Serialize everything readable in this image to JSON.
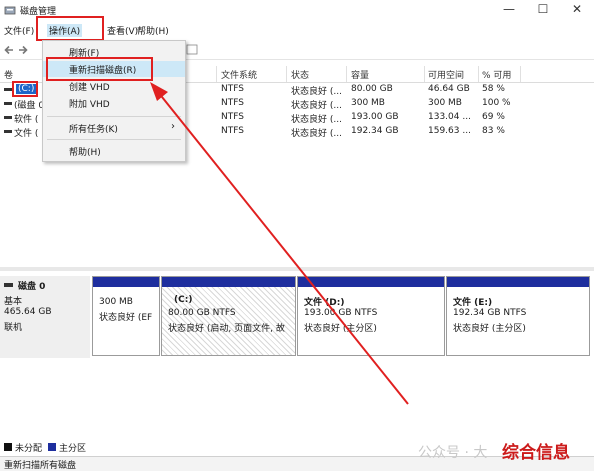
{
  "window": {
    "title": "磁盘管理",
    "minimize": "—",
    "maximize": "☐",
    "close": "✕"
  },
  "menu": [
    "文件(F)",
    "操作(A)",
    "查看(V)",
    "帮助(H)"
  ],
  "dropdown": {
    "items": [
      "刷新(F)",
      "重新扫描磁盘(R)",
      "创建 VHD",
      "附加 VHD",
      "所有任务(K)",
      "帮助(H)"
    ],
    "submenu_arrow": "›"
  },
  "list": {
    "headers": [
      "卷",
      "文件系统",
      "状态",
      "容量",
      "可用空间",
      "% 可用"
    ],
    "rows": [
      {
        "volume": "(C:)",
        "fs": "NTFS",
        "status": "状态良好 (...",
        "capacity": "80.00 GB",
        "free": "46.64 GB",
        "pct": "58 %"
      },
      {
        "volume": "(磁盘 0",
        "fs": "NTFS",
        "status": "状态良好 (...",
        "capacity": "300 MB",
        "free": "300 MB",
        "pct": "100 %"
      },
      {
        "volume": "软件 (",
        "fs": "NTFS",
        "status": "状态良好 (...",
        "capacity": "193.00 GB",
        "free": "133.04 ...",
        "pct": "69 %"
      },
      {
        "volume": "文件 (",
        "fs": "NTFS",
        "status": "状态良好 (...",
        "capacity": "192.34 GB",
        "free": "159.63 ...",
        "pct": "83 %"
      }
    ]
  },
  "disk": {
    "name": "磁盘 0",
    "type": "基本",
    "size": "465.64 GB",
    "state": "联机"
  },
  "partitions": [
    {
      "name": "",
      "size": "300 MB",
      "status": "状态良好 (EF"
    },
    {
      "name": "(C:)",
      "size": "80.00 GB NTFS",
      "status": "状态良好 (启动, 页面文件, 故"
    },
    {
      "name": "文件  (D:)",
      "size": "193.00 GB NTFS",
      "status": "状态良好 (主分区)"
    },
    {
      "name": "文件  (E:)",
      "size": "192.34 GB NTFS",
      "status": "状态良好 (主分区)"
    }
  ],
  "legend": {
    "unallocated": "未分配",
    "primary": "主分区"
  },
  "statusbar": "重新扫描所有磁盘",
  "watermark": {
    "gray": "公众号 · 大",
    "brand": "综合信息"
  },
  "colors": {
    "accent_red": "#e02020",
    "partition_header": "#1e2e9e",
    "highlight": "#cde8f7"
  }
}
